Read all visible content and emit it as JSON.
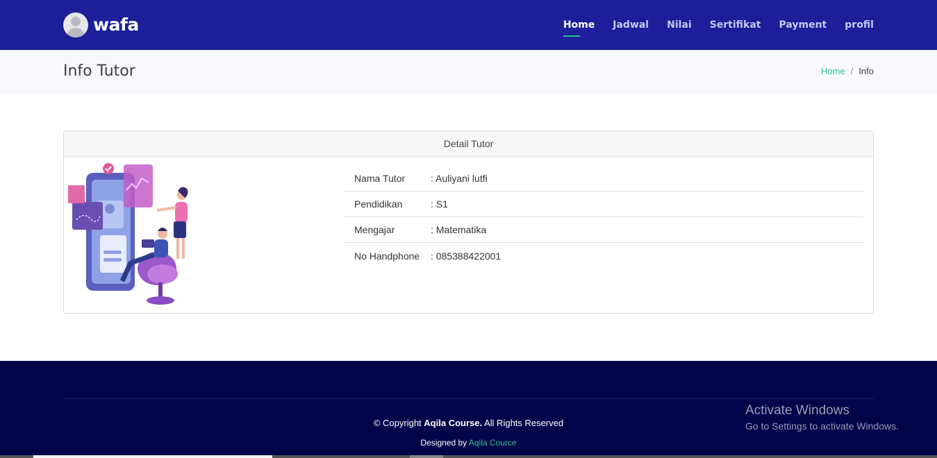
{
  "brand": {
    "name": "wafa",
    "avatar_icon": "user-avatar-icon"
  },
  "nav": {
    "items": [
      {
        "label": "Home",
        "active": true
      },
      {
        "label": "Jadwal",
        "active": false
      },
      {
        "label": "Nilai",
        "active": false
      },
      {
        "label": "Sertifikat",
        "active": false
      },
      {
        "label": "Payment",
        "active": false
      },
      {
        "label": "profil",
        "active": false
      }
    ]
  },
  "page": {
    "title": "Info Tutor",
    "breadcrumb": {
      "home": "Home",
      "separator": "/",
      "current": "Info"
    }
  },
  "card": {
    "header": "Detail Tutor",
    "rows": [
      {
        "label": "Nama Tutor",
        "value": ": Auliyani lutfi"
      },
      {
        "label": "Pendidikan",
        "value": ": S1"
      },
      {
        "label": "Mengajar",
        "value": ": Matematika"
      },
      {
        "label": "No Handphone",
        "value": ": 085388422001"
      }
    ]
  },
  "footer": {
    "copyright_prefix": "© Copyright",
    "copyright_brand": "Aqila Course.",
    "copyright_suffix": "All Rights Reserved",
    "designed_prefix": "Designed by",
    "designed_link": "Aqila Cource"
  },
  "watermark": {
    "title": "Activate Windows",
    "subtitle": "Go to Settings to activate Windows."
  },
  "colors": {
    "topbar": "#1c1f99",
    "accent": "#2bc48a",
    "footer": "#03034a"
  }
}
